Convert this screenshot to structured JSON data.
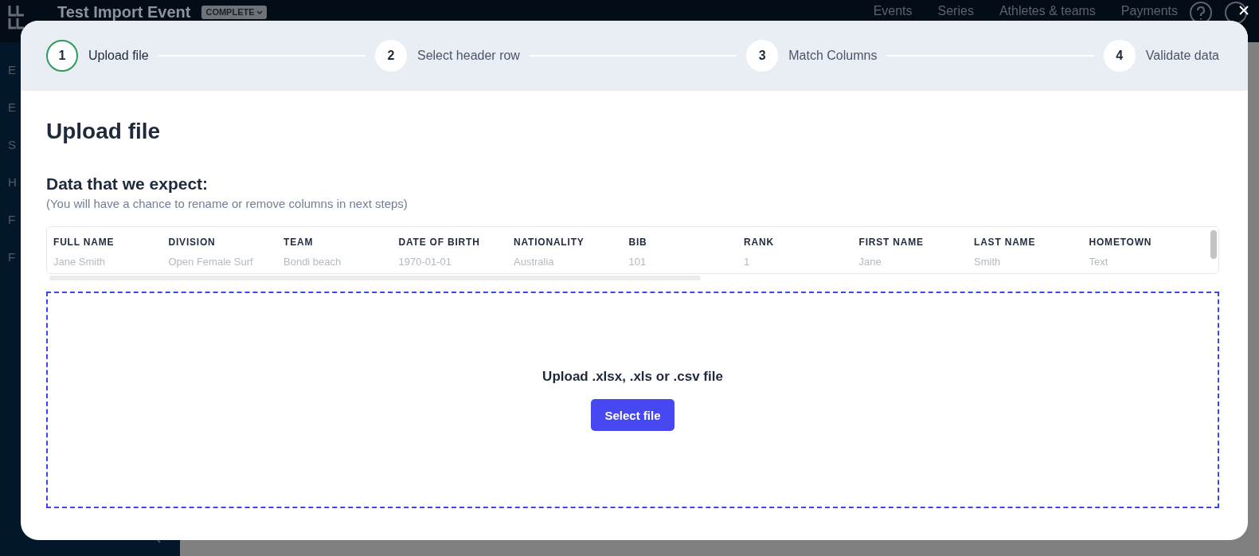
{
  "app_bar": {
    "title": "Test Import Event",
    "status_badge": "COMPLETE",
    "nav": [
      "Events",
      "Series",
      "Athletes & teams",
      "Payments"
    ]
  },
  "sidebar": {
    "items": [
      "E",
      "E",
      "S",
      "H",
      "F",
      "F"
    ]
  },
  "dialog": {
    "steps": [
      {
        "number": "1",
        "label": "Upload file",
        "selected": true
      },
      {
        "number": "2",
        "label": "Select header row",
        "selected": false
      },
      {
        "number": "3",
        "label": "Match Columns",
        "selected": false
      },
      {
        "number": "4",
        "label": "Validate data",
        "selected": false
      }
    ],
    "title": "Upload file",
    "section_title": "Data that we expect:",
    "section_note": "(You will have a chance to rename or remove columns in next steps)",
    "table": {
      "columns": [
        "FULL NAME",
        "DIVISION",
        "TEAM",
        "DATE OF BIRTH",
        "NATIONALITY",
        "BIB",
        "RANK",
        "FIRST NAME",
        "LAST NAME",
        "HOMETOWN"
      ],
      "rows": [
        [
          "Jane Smith",
          "Open Female Surf",
          "Bondi beach",
          "1970-01-01",
          "Australia",
          "101",
          "1",
          "Jane",
          "Smith",
          "Text"
        ]
      ]
    },
    "dropzone": {
      "prompt": "Upload .xlsx, .xls or .csv file",
      "button": "Select file"
    }
  }
}
